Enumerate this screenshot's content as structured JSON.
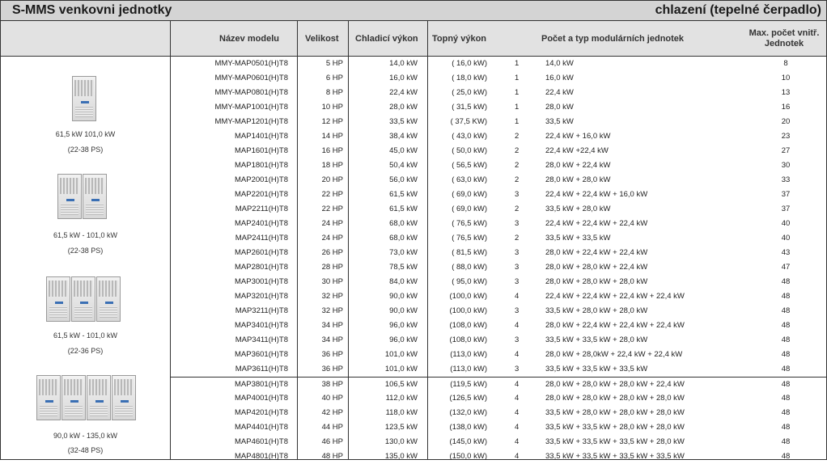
{
  "title": {
    "left": "S-MMS venkovni jednotky",
    "right": "chlazení (tepelné čerpadlo)"
  },
  "headers": {
    "model": "Název modelu",
    "size": "Velikost",
    "cooling": "Chladicí výkon",
    "heating": "Topný výkon",
    "modules": "Počet a typ modulárních jednotek",
    "max_line1": "Max. počet vnitř.",
    "max_line2": "Jednotek"
  },
  "groups": [
    {
      "range": "61,5 kW   101,0 kW",
      "ps": "(22-38 PS)",
      "icon": "outdoor-unit-single-icon"
    },
    {
      "range": "61,5 kW - 101,0 kW",
      "ps": "(22-38 PS)",
      "icon": "outdoor-unit-double-icon"
    },
    {
      "range": "61,5 kW - 101,0 kW",
      "ps": "(22-36 PS)",
      "icon": "outdoor-unit-triple-icon"
    },
    {
      "range": "90,0 kW - 135,0 kW",
      "ps": "(32-48 PS)",
      "icon": "outdoor-unit-quad-icon"
    }
  ],
  "rows": [
    [
      "MMY-MAP0501(H)T8",
      "5 HP",
      "14,0 kW",
      "( 16,0 kW)",
      "1",
      "14,0 kW",
      "8"
    ],
    [
      "MMY-MAP0601(H)T8",
      "6 HP",
      "16,0 kW",
      "( 18,0 kW)",
      "1",
      "16,0 kW",
      "10"
    ],
    [
      "MMY-MAP0801(H)T8",
      "8 HP",
      "22,4 kW",
      "( 25,0 kW)",
      "1",
      "22,4 kW",
      "13"
    ],
    [
      "MMY-MAP1001(H)T8",
      "10 HP",
      "28,0 kW",
      "( 31,5 kW)",
      "1",
      "28,0 kW",
      "16"
    ],
    [
      "MMY-MAP1201(H)T8",
      "12 HP",
      "33,5 kW",
      "( 37,5 KW)",
      "1",
      "33,5 kW",
      "20"
    ],
    [
      "MAP1401(H)T8",
      "14 HP",
      "38,4 kW",
      "( 43,0 kW)",
      "2",
      "22,4 kW + 16,0 kW",
      "23"
    ],
    [
      "MAP1601(H)T8",
      "16 HP",
      "45,0 kW",
      "( 50,0 kW)",
      "2",
      "22,4 kW +22,4 kW",
      "27"
    ],
    [
      "MAP1801(H)T8",
      "18 HP",
      "50,4 kW",
      "( 56,5 kW)",
      "2",
      "28,0 kW + 22,4 kW",
      "30"
    ],
    [
      "MAP2001(H)T8",
      "20 HP",
      "56,0 kW",
      "( 63,0 kW)",
      "2",
      "28,0 kW + 28,0 kW",
      "33"
    ],
    [
      "MAP2201(H)T8",
      "22 HP",
      "61,5 kW",
      "( 69,0 kW)",
      "3",
      "22,4 kW + 22,4 kW + 16,0 kW",
      "37"
    ],
    [
      "MAP2211(H)T8",
      "22 HP",
      "61,5 kW",
      "( 69,0 kW)",
      "2",
      "33,5 kW + 28,0 kW",
      "37"
    ],
    [
      "MAP2401(H)T8",
      "24 HP",
      "68,0 kW",
      "( 76,5 kW)",
      "3",
      "22,4 kW + 22,4 kW + 22,4 kW",
      "40"
    ],
    [
      "MAP2411(H)T8",
      "24 HP",
      "68,0 kW",
      "( 76,5 kW)",
      "2",
      "33,5 kW + 33,5 kW",
      "40"
    ],
    [
      "MAP2601(H)T8",
      "26 HP",
      "73,0 kW",
      "( 81,5 kW)",
      "3",
      "28,0 kW + 22,4 kW + 22,4 kW",
      "43"
    ],
    [
      "MAP2801(H)T8",
      "28 HP",
      "78,5 kW",
      "( 88,0 kW)",
      "3",
      "28,0 kW + 28,0 kW + 22,4 kW",
      "47"
    ],
    [
      "MAP3001(H)T8",
      "30 HP",
      "84,0 kW",
      "( 95,0 kW)",
      "3",
      "28,0 kW + 28,0 kW + 28,0 kW",
      "48"
    ],
    [
      "MAP3201(H)T8",
      "32 HP",
      "90,0 kW",
      "(100,0 kW)",
      "4",
      "22,4 kW + 22,4 kW + 22,4 kW + 22,4 kW",
      "48"
    ],
    [
      "MAP3211(H)T8",
      "32 HP",
      "90,0 kW",
      "(100,0 kW)",
      "3",
      "33,5 kW + 28,0 kW + 28,0 kW",
      "48"
    ],
    [
      "MAP3401(H)T8",
      "34 HP",
      "96,0 kW",
      "(108,0 kW)",
      "4",
      "28,0 kW + 22,4 kW + 22,4 kW + 22,4 kW",
      "48"
    ],
    [
      "MAP3411(H)T8",
      "34 HP",
      "96,0 kW",
      "(108,0 kW)",
      "3",
      "33,5 kW + 33,5 kW + 28,0 kW",
      "48"
    ],
    [
      "MAP3601(H)T8",
      "36 HP",
      "101,0 kW",
      "(113,0 kW)",
      "4",
      "28,0 kW + 28,0kW + 22,4 kW + 22,4 kW",
      "48"
    ],
    [
      "MAP3611(H)T8",
      "36 HP",
      "101,0 kW",
      "(113,0 kW)",
      "3",
      "33,5 kW + 33,5 kW + 33,5 kW",
      "48"
    ],
    [
      "MAP3801(H)T8",
      "38 HP",
      "106,5 kW",
      "(119,5 kW)",
      "4",
      "28,0 kW + 28,0 kW + 28,0 kW + 22,4 kW",
      "48"
    ],
    [
      "MAP4001(H)T8",
      "40 HP",
      "112,0 kW",
      "(126,5 kW)",
      "4",
      "28,0 kW + 28,0 kW + 28,0 kW + 28,0 kW",
      "48"
    ],
    [
      "MAP4201(H)T8",
      "42 HP",
      "118,0 kW",
      "(132,0 kW)",
      "4",
      "33,5 kW + 28,0 kW + 28,0 kW + 28,0 kW",
      "48"
    ],
    [
      "MAP4401(H)T8",
      "44 HP",
      "123,5 kW",
      "(138,0 kW)",
      "4",
      "33,5 kW + 33,5 kW + 28,0 kW + 28,0 kW",
      "48"
    ],
    [
      "MAP4601(H)T8",
      "46 HP",
      "130,0 kW",
      "(145,0 kW)",
      "4",
      "33,5 kW + 33,5 kW + 33,5 kW + 28,0 kW",
      "48"
    ],
    [
      "MAP4801(H)T8",
      "48 HP",
      "135,0 kW",
      "(150,0 kW)",
      "4",
      "33,5 kW + 33,5 kW + 33,5 kW + 33,5 kW",
      "48"
    ]
  ]
}
